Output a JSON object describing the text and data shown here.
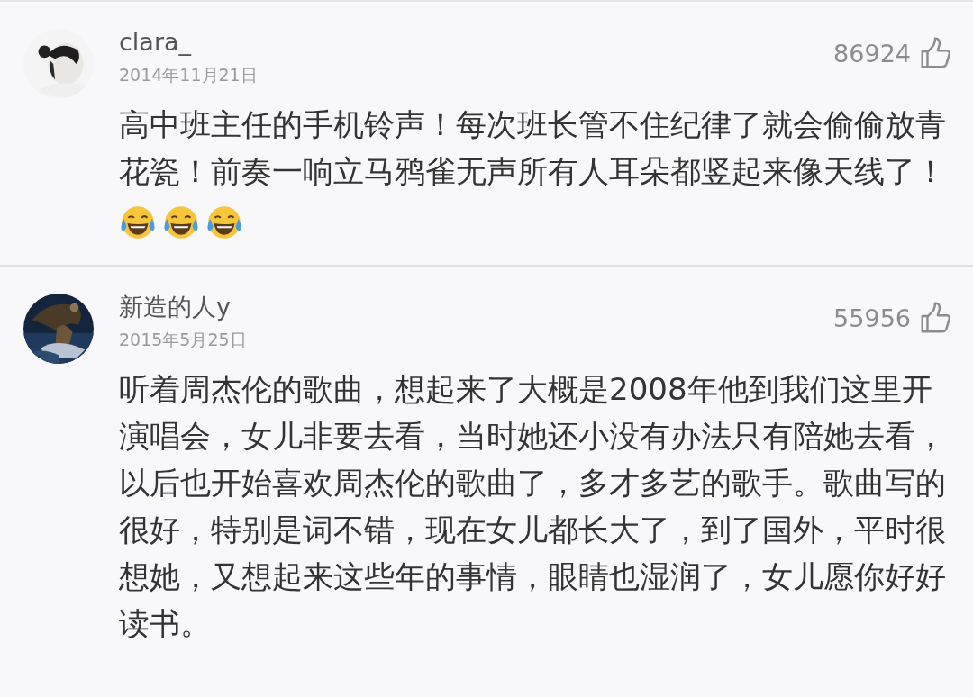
{
  "comments": [
    {
      "user": "clara_",
      "date": "2014年11月21日",
      "likes": "86924",
      "text": "高中班主任的手机铃声！每次班长管不住纪律了就会偷偷放青花瓷！前奏一响立马鸦雀无声所有人耳朵都竖起来像天线了！",
      "emojis": [
        {
          "kind": "laughing-tears"
        },
        {
          "kind": "laughing-tears"
        },
        {
          "kind": "laughing-tears"
        }
      ]
    },
    {
      "user": "新造的人y",
      "date": "2015年5月25日",
      "likes": "55956",
      "text": "听着周杰伦的歌曲，想起来了大概是2008年他到我们这里开演唱会，女儿非要去看，当时她还小没有办法只有陪她去看，以后也开始喜欢周杰伦的歌曲了，多才多艺的歌手。歌曲写的很好，特别是词不错，现在女儿都长大了，到了国外，平时很想她，又想起来这些年的事情，眼睛也湿润了，女儿愿你好好读书。"
    }
  ]
}
